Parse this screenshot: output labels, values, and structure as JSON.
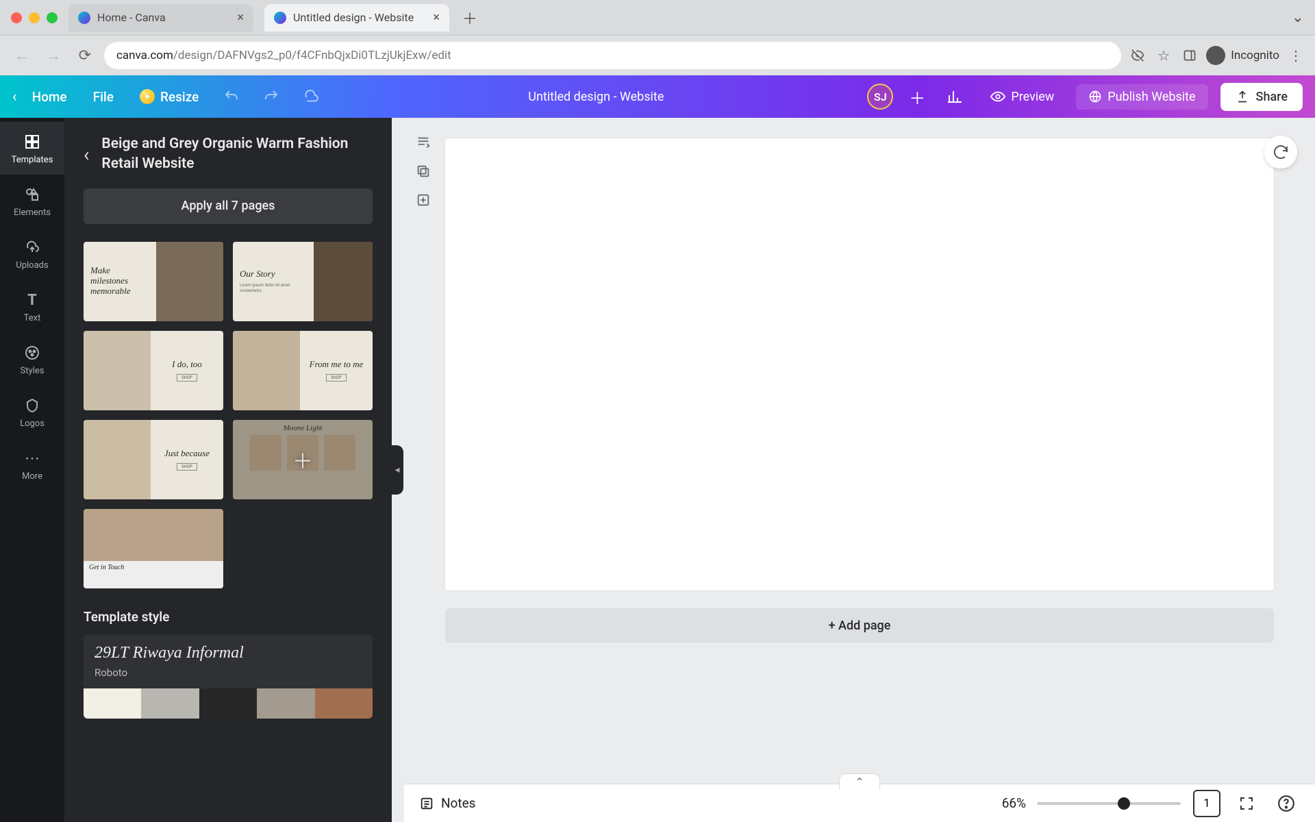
{
  "os": {
    "tabs": [
      {
        "title": "Home - Canva"
      },
      {
        "title": "Untitled design - Website"
      }
    ],
    "incognito_label": "Incognito"
  },
  "url": {
    "host": "canva.com",
    "path": "/design/DAFNVgs2_p0/f4CFnbQjxDi0TLzjUkjExw/edit"
  },
  "topbar": {
    "home": "Home",
    "file": "File",
    "resize": "Resize",
    "design_title": "Untitled design - Website",
    "avatar_initials": "SJ",
    "preview": "Preview",
    "publish": "Publish Website",
    "share": "Share"
  },
  "rail": {
    "items": [
      {
        "label": "Templates"
      },
      {
        "label": "Elements"
      },
      {
        "label": "Uploads"
      },
      {
        "label": "Text"
      },
      {
        "label": "Styles"
      },
      {
        "label": "Logos"
      },
      {
        "label": "More"
      }
    ]
  },
  "side_panel": {
    "title": "Beige and Grey Organic Warm Fashion Retail Website",
    "apply_label": "Apply all 7 pages",
    "pages": [
      {
        "caption": "Make milestones memorable"
      },
      {
        "caption": "Our Story"
      },
      {
        "caption": "I do, too"
      },
      {
        "caption": "From me to me"
      },
      {
        "caption": "Just because"
      },
      {
        "caption": "Moone Light"
      },
      {
        "caption": "Get in Touch"
      }
    ],
    "style_header": "Template style",
    "style_font_main": "29LT Riwaya Informal",
    "style_font_sub": "Roboto",
    "swatches": [
      "#f2efe5",
      "#b9b7b2",
      "#262626",
      "#a39a90",
      "#a16f4f"
    ]
  },
  "canvas": {
    "add_page": "+ Add page"
  },
  "bottom": {
    "notes": "Notes",
    "zoom_pct": "66%",
    "page_count": "1"
  }
}
